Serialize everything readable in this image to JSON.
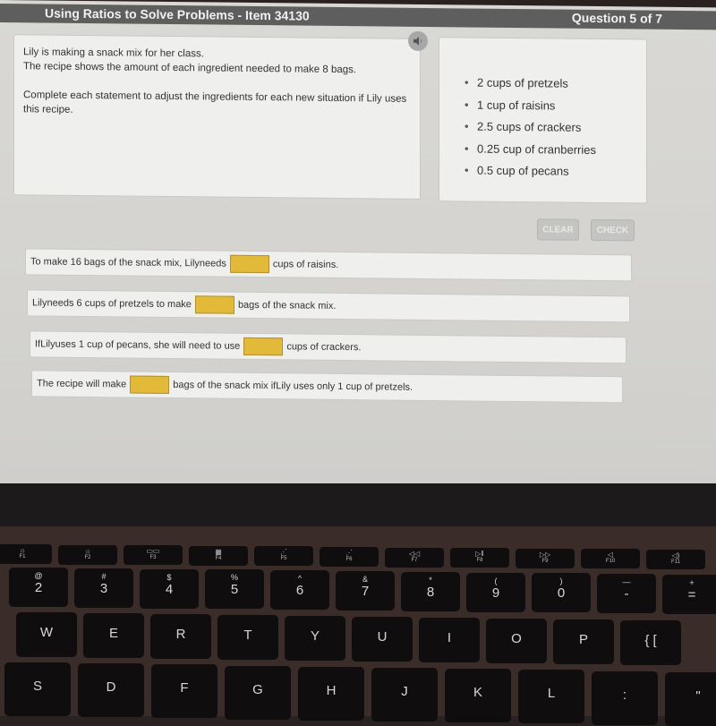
{
  "header": {
    "title": "Using Ratios to Solve Problems - Item 34130",
    "question_counter": "Question 5 of 7"
  },
  "prompt": {
    "line1": "Lily is making a snack mix for her class.",
    "line2": "The recipe shows the amount of each ingredient needed to make 8 bags.",
    "instruction": "Complete each statement to adjust the ingredients for each new situation if Lily uses this recipe."
  },
  "audio_button": {
    "icon": "speaker-icon"
  },
  "recipe": {
    "items": [
      "2 cups of pretzels",
      "1 cup of raisins",
      "2.5 cups of crackers",
      "0.25 cup of cranberries",
      "0.5 cup of pecans"
    ]
  },
  "buttons": {
    "clear": "CLEAR",
    "check": "CHECK"
  },
  "statements": [
    {
      "before": "To make 16 bags of the snack mix, Lilyneeds",
      "answer": "",
      "after": "cups of raisins."
    },
    {
      "before": "Lilyneeds 6 cups of pretzels to make",
      "answer": "",
      "after": "bags of the snack mix."
    },
    {
      "before": "IfLilyuses 1 cup of pecans, she will need to use",
      "answer": "",
      "after": "cups of crackers."
    },
    {
      "before": "The recipe will make",
      "answer": "",
      "after": "bags of the snack mix ifLily uses only 1 cup of pretzels."
    }
  ],
  "colors": {
    "answer_blank": "#e3b93a",
    "titlebar": "#5e5e5e"
  },
  "keyboard": {
    "fkeys": [
      {
        "glyph": "☼",
        "label": "F1"
      },
      {
        "glyph": "☼",
        "label": "F2"
      },
      {
        "glyph": "▭▭",
        "label": "F3"
      },
      {
        "glyph": "▦",
        "label": "F4"
      },
      {
        "glyph": "⋰",
        "label": "F5"
      },
      {
        "glyph": "⋰",
        "label": "F6"
      },
      {
        "glyph": "◁◁",
        "label": "F7"
      },
      {
        "glyph": "▷‖",
        "label": "F8"
      },
      {
        "glyph": "▷▷",
        "label": "F9"
      },
      {
        "glyph": "◁",
        "label": "F10"
      },
      {
        "glyph": "◁)",
        "label": "F11"
      }
    ],
    "number_row": [
      {
        "top": "@",
        "main": "2"
      },
      {
        "top": "#",
        "main": "3"
      },
      {
        "top": "$",
        "main": "4"
      },
      {
        "top": "%",
        "main": "5"
      },
      {
        "top": "^",
        "main": "6"
      },
      {
        "top": "&",
        "main": "7"
      },
      {
        "top": "*",
        "main": "8"
      },
      {
        "top": "(",
        "main": "9"
      },
      {
        "top": ")",
        "main": "0"
      },
      {
        "top": "—",
        "main": "-"
      },
      {
        "top": "+",
        "main": "="
      }
    ],
    "qwerty_row": [
      "W",
      "E",
      "R",
      "T",
      "Y",
      "U",
      "I",
      "O",
      "P",
      "{ ["
    ],
    "home_row": [
      "S",
      "D",
      "F",
      "G",
      "H",
      "J",
      "K",
      "L",
      ":",
      "\""
    ]
  }
}
